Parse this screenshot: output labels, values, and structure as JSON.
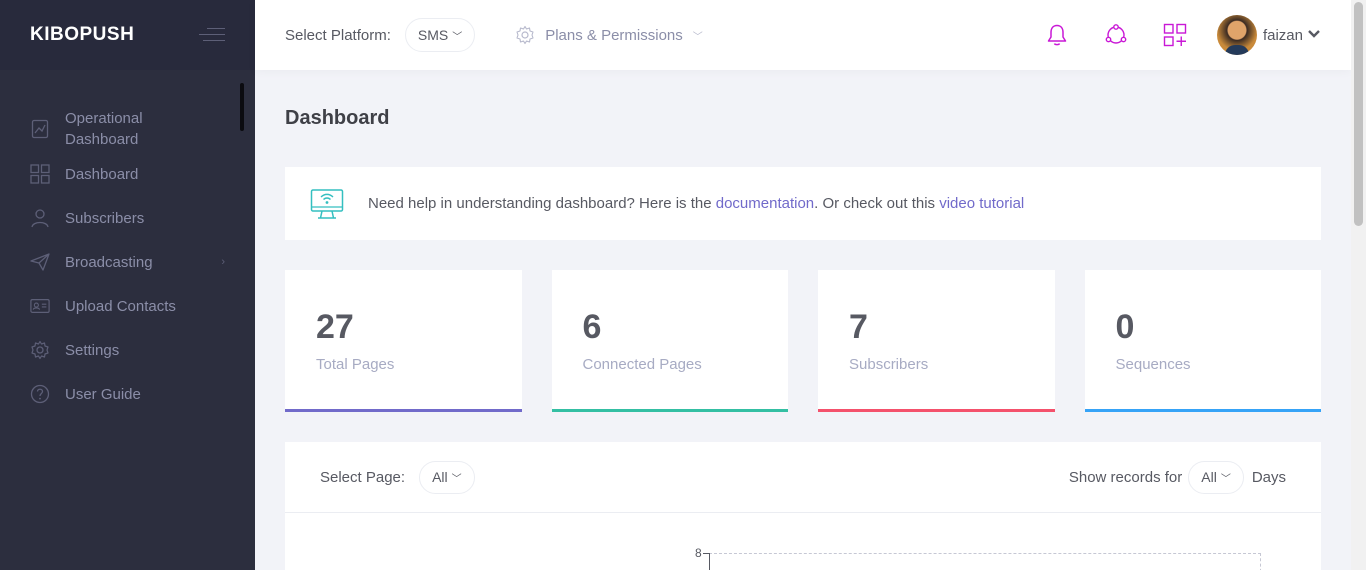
{
  "sidebar": {
    "brand": "KIBOPUSH",
    "items": [
      {
        "label": "Operational Dashboard"
      },
      {
        "label": "Dashboard"
      },
      {
        "label": "Subscribers"
      },
      {
        "label": "Broadcasting"
      },
      {
        "label": "Upload Contacts"
      },
      {
        "label": "Settings"
      },
      {
        "label": "User Guide"
      }
    ]
  },
  "topbar": {
    "platform_label": "Select Platform:",
    "platform_value": "SMS",
    "plans_label": "Plans & Permissions",
    "user_name": "faizan"
  },
  "main": {
    "title": "Dashboard",
    "help": {
      "text_before": "Need help in understanding dashboard? Here is the ",
      "doc_link": "documentation",
      "text_middle": ". Or check out this ",
      "video_link": "video tutorial"
    },
    "stats": [
      {
        "value": "27",
        "label": "Total Pages",
        "color": "#716aca"
      },
      {
        "value": "6",
        "label": "Connected Pages",
        "color": "#34bfa3"
      },
      {
        "value": "7",
        "label": "Subscribers",
        "color": "#f4516c"
      },
      {
        "value": "0",
        "label": "Sequences",
        "color": "#36a3f7"
      }
    ],
    "filters": {
      "select_page_label": "Select Page:",
      "select_page_value": "All",
      "show_records_label": "Show records for",
      "show_records_value": "All",
      "days_label": "Days"
    },
    "chart": {
      "y_tick_top": "8"
    }
  },
  "colors": {
    "sidebar_bg": "#2c2e3e",
    "accent_magenta": "#c918d6",
    "link": "#716aca",
    "help_icon": "#34bfc0"
  }
}
